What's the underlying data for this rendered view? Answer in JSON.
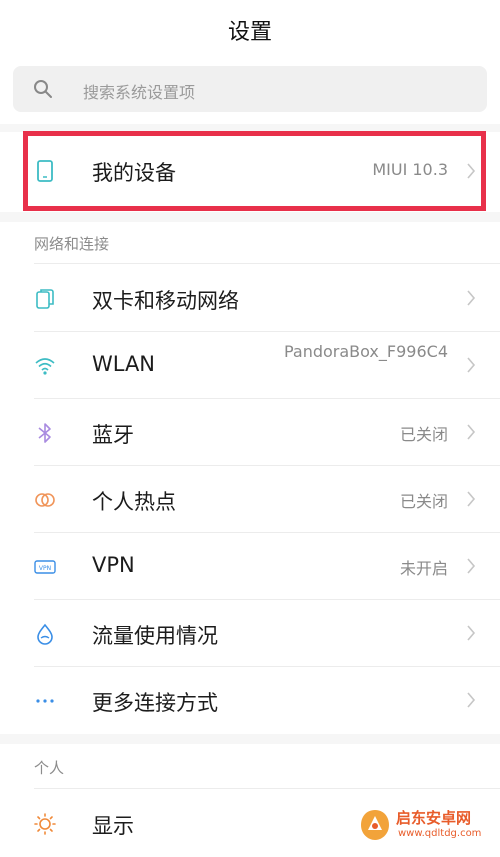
{
  "header": {
    "title": "设置"
  },
  "search": {
    "placeholder": "搜索系统设置项",
    "icon": "search-icon"
  },
  "device": {
    "label": "我的设备",
    "value": "MIUI 10.3",
    "icon": "phone-icon"
  },
  "sections": {
    "network": {
      "title": "网络和连接"
    },
    "personal": {
      "title": "个人"
    }
  },
  "network_items": [
    {
      "label": "双卡和移动网络",
      "value": "",
      "icon": "dual-sim-icon"
    },
    {
      "label": "WLAN",
      "value": "PandoraBox_F996C4",
      "icon": "wifi-icon"
    },
    {
      "label": "蓝牙",
      "value": "已关闭",
      "icon": "bluetooth-icon"
    },
    {
      "label": "个人热点",
      "value": "已关闭",
      "icon": "hotspot-icon"
    },
    {
      "label": "VPN",
      "value": "未开启",
      "icon": "vpn-icon"
    },
    {
      "label": "流量使用情况",
      "value": "",
      "icon": "data-usage-icon"
    },
    {
      "label": "更多连接方式",
      "value": "",
      "icon": "more-icon"
    }
  ],
  "personal_items": [
    {
      "label": "显示",
      "value": "",
      "icon": "display-icon"
    }
  ],
  "watermark": {
    "name": "启东安卓网",
    "url": "www.qdltdg.com"
  },
  "colors": {
    "highlight": "#e8304a",
    "icon_accent": "#3dbcc4",
    "bluetooth": "#a98be0",
    "hotspot": "#f0955a",
    "data": "#3a8ee6",
    "display": "#f08a3a"
  }
}
